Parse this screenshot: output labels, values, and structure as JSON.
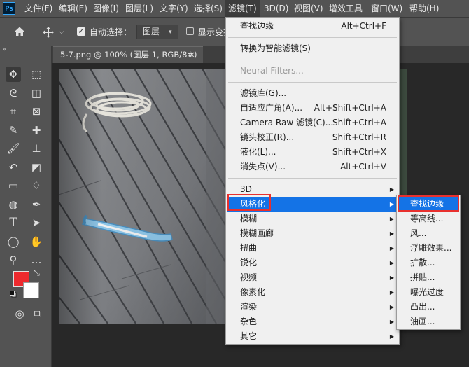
{
  "app": {
    "logo": "Ps"
  },
  "menubar": [
    {
      "label": "文件(F)"
    },
    {
      "label": "编辑(E)"
    },
    {
      "label": "图像(I)"
    },
    {
      "label": "图层(L)"
    },
    {
      "label": "文字(Y)"
    },
    {
      "label": "选择(S)"
    },
    {
      "label": "滤镜(T)",
      "active": true
    },
    {
      "label": "3D(D)"
    },
    {
      "label": "视图(V)"
    },
    {
      "label": "增效工具"
    },
    {
      "label": "窗口(W)"
    },
    {
      "label": "帮助(H)"
    }
  ],
  "options_bar": {
    "auto_select_label": "自动选择：",
    "auto_select_checked": true,
    "layer_select_value": "图层",
    "transform_label": "显示变换控件",
    "home_icon": "home-icon",
    "move_icon": "move-tool-icon"
  },
  "document_tab": {
    "title": "5-7.png @ 100% (图层 1, RGB/8#)",
    "close": "×"
  },
  "filter_menu": {
    "items": [
      {
        "label": "查找边缘",
        "shortcut": "Alt+Ctrl+F"
      },
      {
        "separator": true
      },
      {
        "label": "转换为智能滤镜(S)"
      },
      {
        "separator": true
      },
      {
        "label": "Neural Filters...",
        "disabled": true
      },
      {
        "separator": true
      },
      {
        "label": "滤镜库(G)..."
      },
      {
        "label": "自适应广角(A)...",
        "shortcut": "Alt+Shift+Ctrl+A"
      },
      {
        "label": "Camera Raw 滤镜(C)...",
        "shortcut": "Shift+Ctrl+A"
      },
      {
        "label": "镜头校正(R)...",
        "shortcut": "Shift+Ctrl+R"
      },
      {
        "label": "液化(L)...",
        "shortcut": "Shift+Ctrl+X"
      },
      {
        "label": "消失点(V)...",
        "shortcut": "Alt+Ctrl+V"
      },
      {
        "separator": true
      },
      {
        "label": "3D",
        "submenu": true
      },
      {
        "label": "风格化",
        "submenu": true,
        "highlighted": true
      },
      {
        "label": "模糊",
        "submenu": true
      },
      {
        "label": "模糊画廊",
        "submenu": true
      },
      {
        "label": "扭曲",
        "submenu": true
      },
      {
        "label": "锐化",
        "submenu": true
      },
      {
        "label": "视频",
        "submenu": true
      },
      {
        "label": "像素化",
        "submenu": true
      },
      {
        "label": "渲染",
        "submenu": true
      },
      {
        "label": "杂色",
        "submenu": true
      },
      {
        "label": "其它",
        "submenu": true
      }
    ]
  },
  "stylize_submenu": {
    "items": [
      {
        "label": "查找边缘",
        "highlighted": true
      },
      {
        "label": "等高线..."
      },
      {
        "label": "风..."
      },
      {
        "label": "浮雕效果..."
      },
      {
        "label": "扩散..."
      },
      {
        "label": "拼贴..."
      },
      {
        "label": "曝光过度"
      },
      {
        "label": "凸出..."
      },
      {
        "label": "油画..."
      }
    ]
  },
  "colors": {
    "foreground": "#ee2a2e",
    "background": "#ffffff",
    "highlight": "#1473e6",
    "annotation": "#e8302e"
  }
}
